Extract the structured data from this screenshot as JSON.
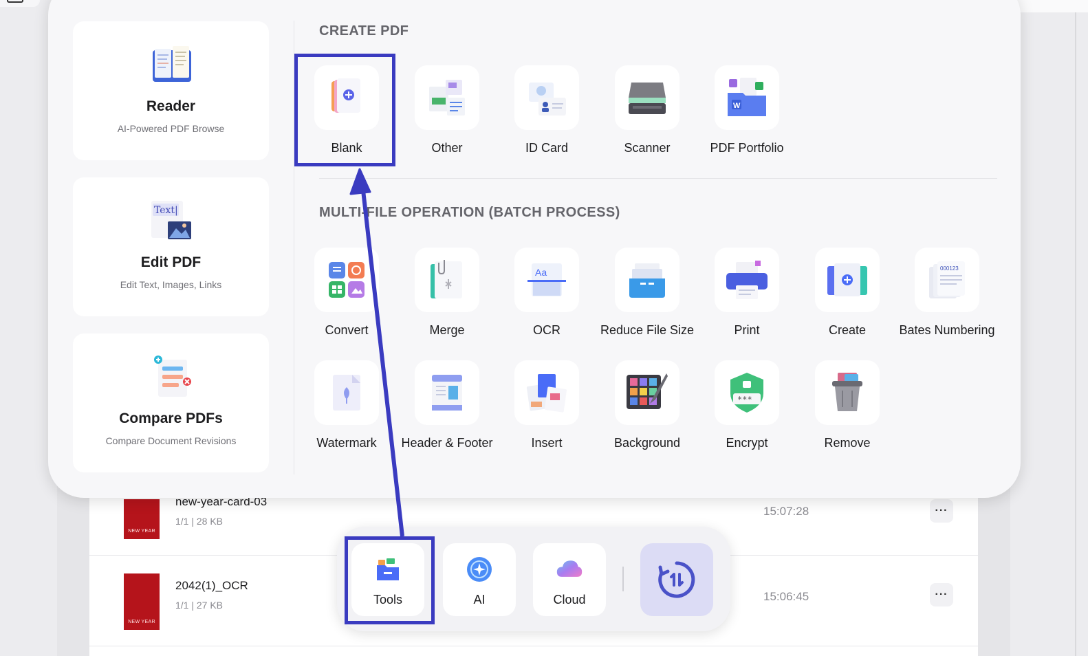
{
  "popup": {
    "left_cards": [
      {
        "title": "Reader",
        "subtitle": "AI-Powered PDF Browse",
        "icon": "reader-book-icon"
      },
      {
        "title": "Edit PDF",
        "subtitle": "Edit Text, Images, Links",
        "icon": "edit-text-icon",
        "icon_text": "Text|"
      },
      {
        "title": "Compare PDFs",
        "subtitle": "Compare Document Revisions",
        "icon": "compare-documents-icon"
      }
    ],
    "create_section": {
      "title": "CREATE PDF",
      "items": [
        {
          "label": "Blank",
          "icon": "blank-page-icon"
        },
        {
          "label": "Other",
          "icon": "other-formats-icon"
        },
        {
          "label": "ID Card",
          "icon": "id-card-icon"
        },
        {
          "label": "Scanner",
          "icon": "scanner-icon"
        },
        {
          "label": "PDF Portfolio",
          "icon": "portfolio-icon"
        }
      ]
    },
    "batch_section": {
      "title": "MULTI-FILE OPERATION (BATCH PROCESS)",
      "items": [
        {
          "label": "Convert",
          "icon": "convert-icon"
        },
        {
          "label": "Merge",
          "icon": "merge-icon"
        },
        {
          "label": "OCR",
          "icon": "ocr-icon",
          "icon_text": "Aa"
        },
        {
          "label": "Reduce File Size",
          "icon": "reduce-size-icon"
        },
        {
          "label": "Print",
          "icon": "print-icon"
        },
        {
          "label": "Create",
          "icon": "create-icon"
        },
        {
          "label": "Bates Numbering",
          "icon": "bates-numbering-icon",
          "icon_text": "000123"
        },
        {
          "label": "Watermark",
          "icon": "watermark-icon"
        },
        {
          "label": "Header & Footer",
          "icon": "header-footer-icon"
        },
        {
          "label": "Insert",
          "icon": "insert-icon"
        },
        {
          "label": "Background",
          "icon": "background-icon"
        },
        {
          "label": "Encrypt",
          "icon": "encrypt-icon",
          "icon_text": "***"
        },
        {
          "label": "Remove",
          "icon": "remove-trash-icon"
        }
      ]
    }
  },
  "files": [
    {
      "name": "new-year-card-03",
      "meta": "1/1 | 28 KB",
      "time": "15:07:28",
      "thumb_text": "NEW YEAR"
    },
    {
      "name": "2042(1)_OCR",
      "meta": "1/1 | 27 KB",
      "time": "15:06:45",
      "thumb_text": "NEW YEAR"
    }
  ],
  "dock": {
    "items": [
      {
        "label": "Tools",
        "icon": "tools-icon"
      },
      {
        "label": "AI",
        "icon": "ai-sparkle-icon"
      },
      {
        "label": "Cloud",
        "icon": "cloud-icon"
      }
    ],
    "sync_icon": "sync-transfer-icon",
    "more_label": "···"
  },
  "colors": {
    "highlight": "#3a3bc0",
    "accent": "#4a6cf7",
    "sync_bg": "#dcdcf5"
  }
}
